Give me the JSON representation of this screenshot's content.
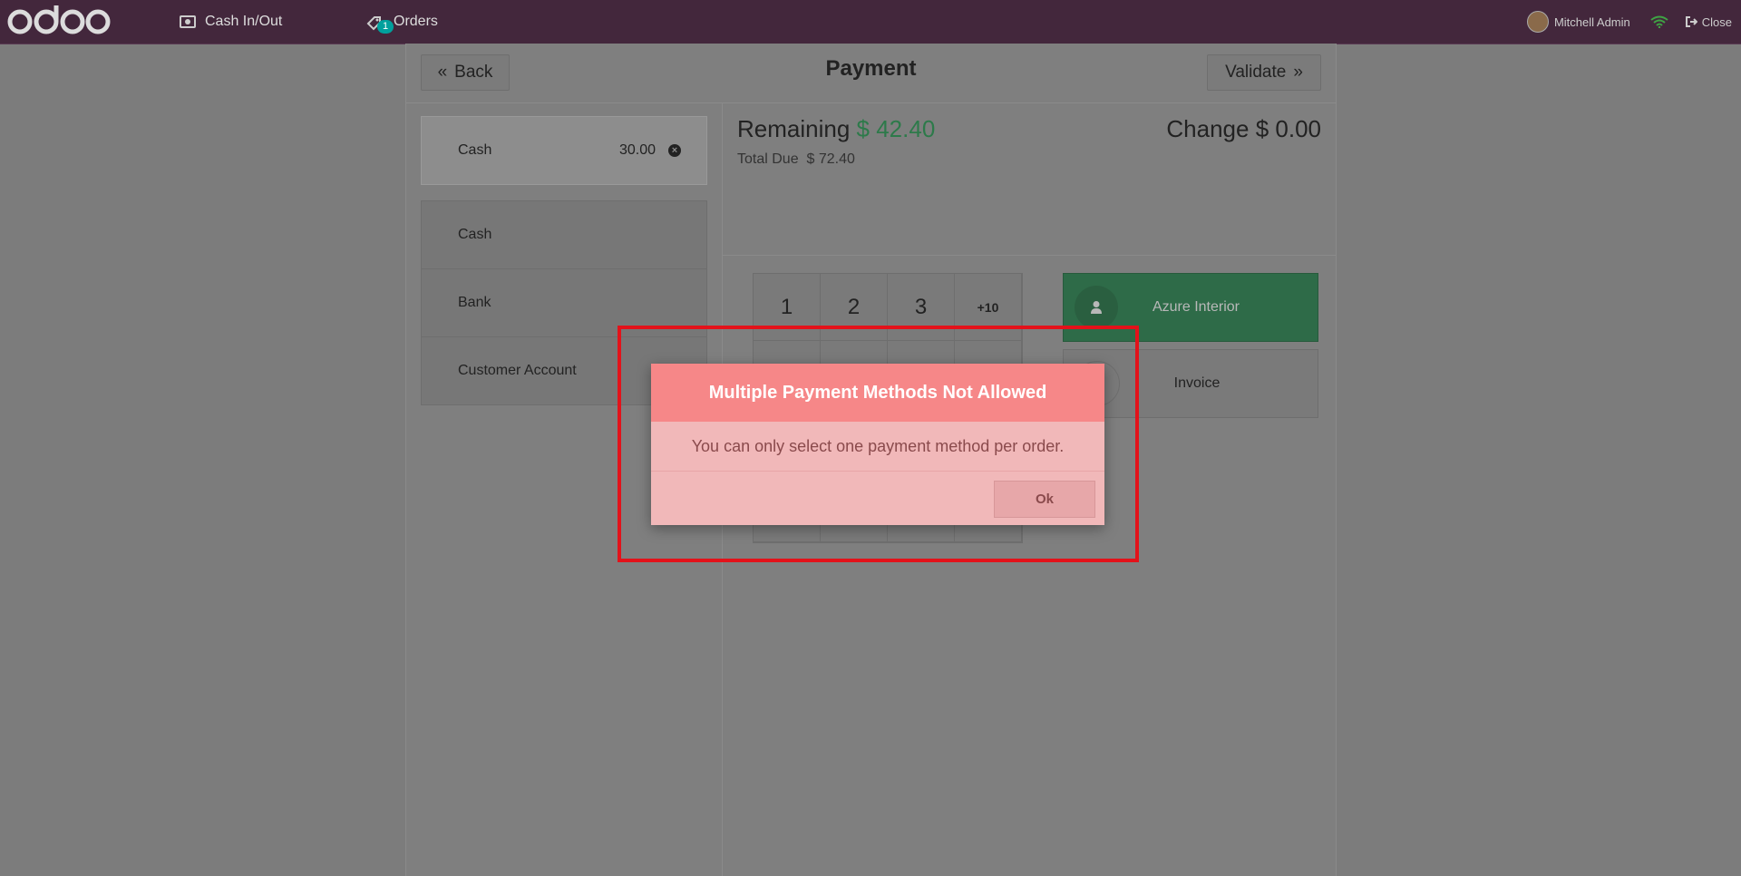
{
  "topbar": {
    "cash_in_out": "Cash In/Out",
    "orders": "Orders",
    "orders_count": "1",
    "user_name": "Mitchell Admin",
    "close": "Close"
  },
  "payment": {
    "title": "Payment",
    "back": "Back",
    "validate": "Validate",
    "lines": [
      {
        "method": "Cash",
        "amount": "30.00"
      }
    ],
    "methods": [
      "Cash",
      "Bank",
      "Customer Account"
    ],
    "remaining_label": "Remaining",
    "remaining_value": "$ 42.40",
    "change_label": "Change",
    "change_value": "$ 0.00",
    "total_due_label": "Total Due",
    "total_due_value": "$ 72.40",
    "keys": [
      "1",
      "2",
      "3",
      "+10"
    ],
    "customer": "Azure Interior",
    "invoice": "Invoice"
  },
  "dialog": {
    "title": "Multiple Payment Methods Not Allowed",
    "message": "You can only select one payment method per order.",
    "ok": "Ok"
  },
  "colors": {
    "topbar": "#43273c",
    "dialog_header": "#f68788",
    "dialog_body": "#f1b8b9",
    "highlight": "#e3121a",
    "remaining": "#2d7a4a"
  }
}
